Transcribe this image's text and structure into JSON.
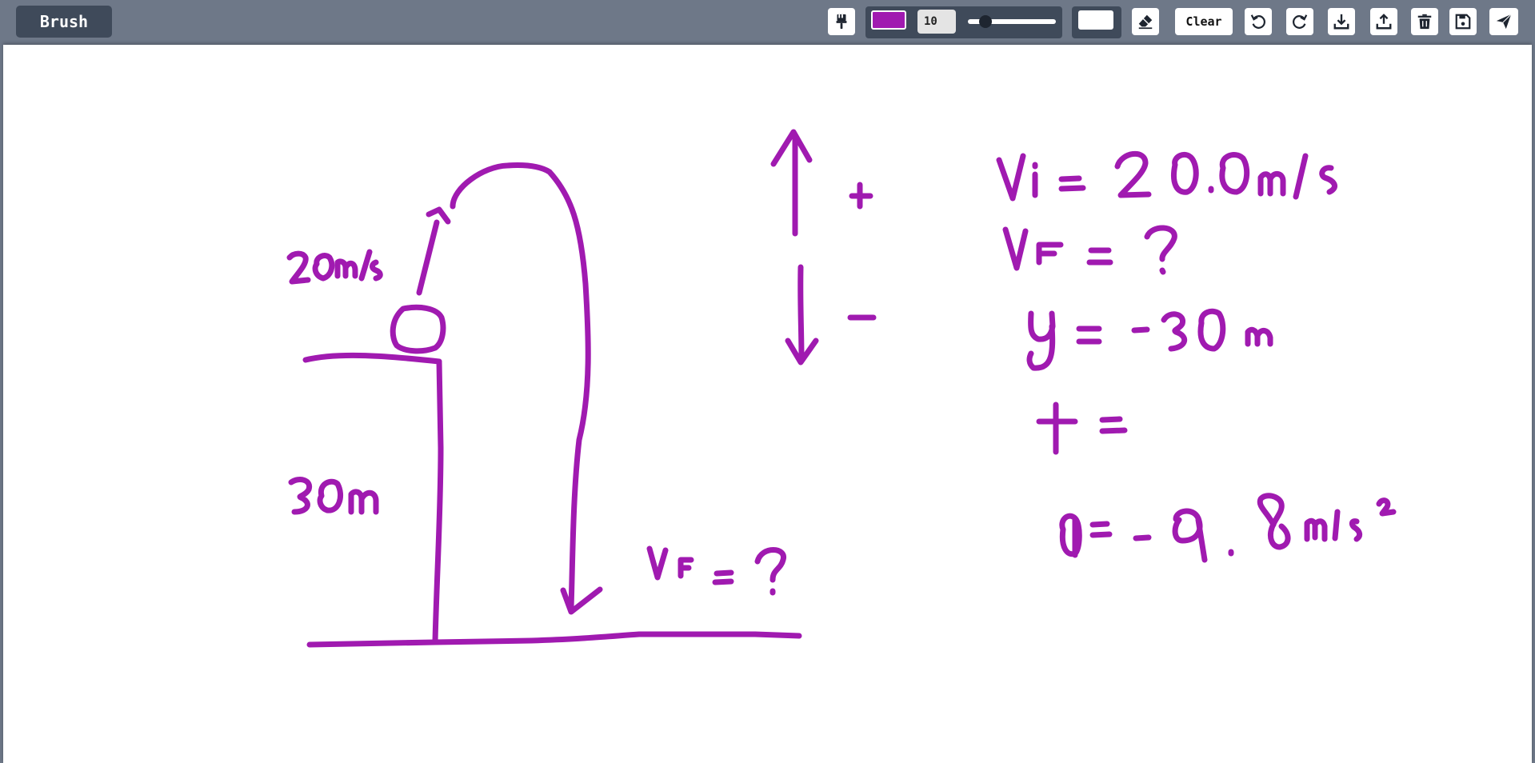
{
  "toolbar": {
    "mode_label": "Brush",
    "brush_size": "10",
    "brush_size_max": 50,
    "brush_color": "#a01ab0",
    "secondary_color": "#ffffff",
    "clear_label": "Clear",
    "icons": [
      "brush-icon",
      "eraser-icon",
      "undo-icon",
      "redo-icon",
      "download-icon",
      "upload-icon",
      "trash-icon",
      "save-icon",
      "send-icon"
    ]
  },
  "canvas": {
    "stroke_color": "#a01ab0",
    "background": "#ffffff"
  }
}
